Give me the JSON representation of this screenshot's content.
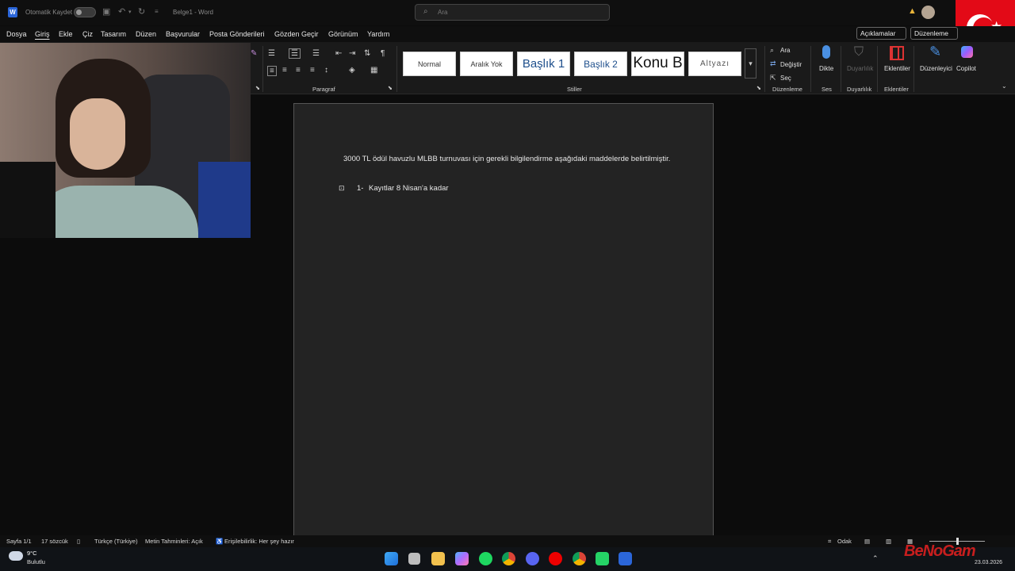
{
  "titlebar": {
    "autosave_label": "Otomatik Kaydet",
    "doc_title": "Belge1 - Word",
    "search_placeholder": "Ara"
  },
  "menu": [
    "Dosya",
    "Giriş",
    "Ekle",
    "Çiz",
    "Tasarım",
    "Düzen",
    "Başvurular",
    "Posta Gönderileri",
    "Gözden Geçir",
    "Görünüm",
    "Yardım"
  ],
  "menu_active": "Giriş",
  "header_buttons": {
    "comments": "Açıklamalar",
    "edit": "Düzenleme"
  },
  "ribbon": {
    "groups": {
      "paragraph": "Paragraf",
      "styles": "Stiller",
      "editing": "Düzenleme",
      "voice": "Ses",
      "sensitivity": "Duyarlılık",
      "addins": "Eklentiler"
    },
    "styles": [
      "Normal",
      "Aralık Yok",
      "Başlık 1",
      "Başlık 2",
      "Konu B",
      "Altyazı"
    ],
    "editing": {
      "find": "Ara",
      "replace": "Değiştir",
      "select": "Seç"
    },
    "voice": {
      "dictate": "Dikte"
    },
    "sensitivity": {
      "label": "Duyarlılık"
    },
    "addins": {
      "label": "Eklentiler"
    },
    "editor": "Düzenleyici",
    "copilot": "Copilot"
  },
  "document": {
    "paragraph": "3000 TL ödül havuzlu MLBB turnuvası için gerekli bilgilendirme aşağıdaki maddelerde belirtilmiştir.",
    "list_items": [
      {
        "number": "1-",
        "text": "Kayıtlar 8 Nisan'a kadar"
      }
    ]
  },
  "status": {
    "page": "Sayfa 1/1",
    "words": "17 sözcük",
    "language": "Türkçe (Türkiye)",
    "predictions": "Metin Tahminleri: Açık",
    "accessibility": "Erişilebilirlik: Her şey hazır",
    "focus": "Odak"
  },
  "taskbar": {
    "temp": "9°C",
    "weather": "Bulutlu",
    "date": "23.03.2026"
  },
  "overlay": {
    "logo": "BeNoGam"
  },
  "colors": {
    "accent": "#2b66d9",
    "flag": "#e30a17",
    "page_bg": "#232323"
  }
}
